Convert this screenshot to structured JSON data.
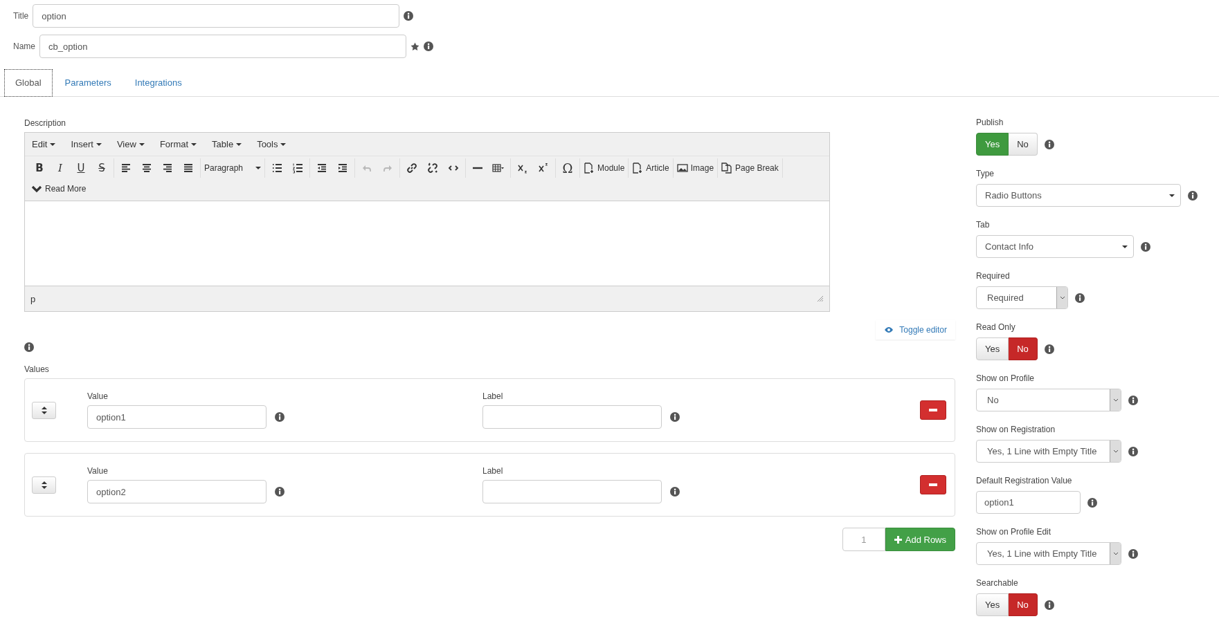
{
  "header": {
    "fields": [
      {
        "label": "Title",
        "value": "option",
        "required": false
      },
      {
        "label": "Name",
        "value": "cb_option",
        "required": true
      }
    ]
  },
  "tabs": [
    {
      "label": "Global",
      "selected": true
    },
    {
      "label": "Parameters",
      "selected": false
    },
    {
      "label": "Integrations",
      "selected": false
    }
  ],
  "description": {
    "label": "Description",
    "menubar": [
      "Edit",
      "Insert",
      "View",
      "Format",
      "Table",
      "Tools"
    ],
    "toolbar": [
      [
        {
          "kind": "glyph",
          "label": "B"
        },
        {
          "kind": "glyph",
          "label": "I"
        },
        {
          "kind": "glyph",
          "label": "U"
        },
        {
          "kind": "glyph",
          "label": "S"
        }
      ],
      [
        {
          "kind": "icon",
          "disabled": false
        },
        {
          "kind": "icon",
          "disabled": false
        },
        {
          "kind": "icon",
          "disabled": false
        },
        {
          "kind": "icon",
          "disabled": false
        }
      ],
      [
        {
          "kind": "select",
          "label": "Paragraph"
        }
      ],
      [
        {
          "kind": "icon",
          "disabled": false
        },
        {
          "kind": "icon",
          "disabled": false
        }
      ],
      [
        {
          "kind": "icon",
          "disabled": false
        },
        {
          "kind": "icon",
          "disabled": false
        }
      ],
      [
        {
          "kind": "icon",
          "disabled": true
        },
        {
          "kind": "icon",
          "disabled": true
        }
      ],
      [
        {
          "kind": "icon",
          "disabled": false
        },
        {
          "kind": "icon",
          "disabled": false
        },
        {
          "kind": "icon",
          "disabled": false
        }
      ],
      [
        {
          "kind": "icon",
          "disabled": false
        },
        {
          "kind": "icon",
          "disabled": false
        }
      ],
      [
        {
          "kind": "icon",
          "disabled": false
        },
        {
          "kind": "icon",
          "disabled": false
        }
      ],
      [
        {
          "kind": "glyph",
          "label": "Ω"
        }
      ],
      [
        {
          "kind": "labeled",
          "label": "Module"
        }
      ],
      [
        {
          "kind": "labeled",
          "label": "Article"
        }
      ],
      [
        {
          "kind": "labeled",
          "label": "Image"
        }
      ],
      [
        {
          "kind": "labeled",
          "label": "Page Break"
        }
      ],
      [
        {
          "kind": "labeled",
          "label": "Read More"
        }
      ]
    ],
    "statusbar": "p",
    "toggle": "Toggle editor"
  },
  "values": {
    "label": "Values",
    "rows": [
      {
        "value_label": "Value",
        "value": "option1",
        "label_label": "Label"
      },
      {
        "value_label": "Value",
        "value": "option2",
        "label_label": "Label"
      }
    ],
    "count": "1",
    "add_button": "Add Rows"
  },
  "settings": [
    {
      "kind": "toggle",
      "label": "Publish",
      "options": [
        {
          "label": "Yes",
          "selected": true
        },
        {
          "label": "No",
          "selected": false
        }
      ]
    },
    {
      "kind": "dropdown",
      "label": "Type",
      "value": "Radio Buttons"
    },
    {
      "kind": "dropdown",
      "label": "Tab",
      "value": "Contact Info"
    },
    {
      "kind": "select",
      "label": "Required",
      "value": "Required"
    },
    {
      "kind": "toggle",
      "label": "Read Only",
      "options": [
        {
          "label": "Yes",
          "selected": false
        },
        {
          "label": "No",
          "selected": true
        }
      ]
    },
    {
      "kind": "select",
      "label": "Show on Profile",
      "value": "No"
    },
    {
      "kind": "select",
      "label": "Show on Registration",
      "value": "Yes, 1 Line with Empty Title"
    },
    {
      "kind": "text",
      "label": "Default Registration Value",
      "value": "option1"
    },
    {
      "kind": "select",
      "label": "Show on Profile Edit",
      "value": "Yes, 1 Line with Empty Title"
    },
    {
      "kind": "toggle",
      "label": "Searchable",
      "options": [
        {
          "label": "Yes",
          "selected": false
        },
        {
          "label": "No",
          "selected": true
        }
      ]
    }
  ]
}
